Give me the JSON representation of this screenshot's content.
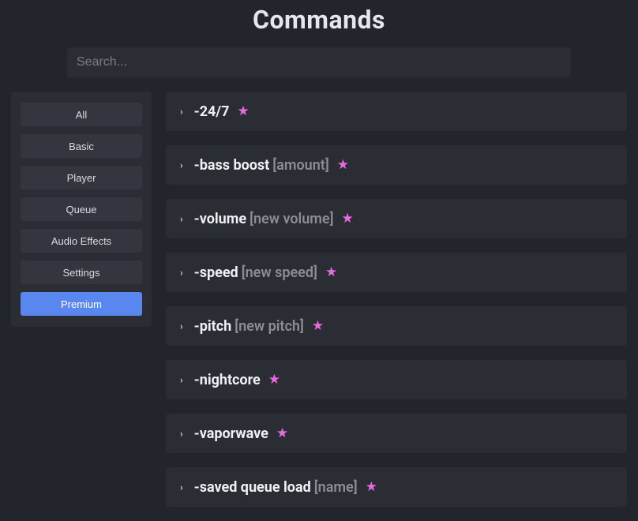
{
  "header": {
    "title": "Commands"
  },
  "search": {
    "placeholder": "Search..."
  },
  "sidebar": {
    "items": [
      {
        "label": "All",
        "active": false
      },
      {
        "label": "Basic",
        "active": false
      },
      {
        "label": "Player",
        "active": false
      },
      {
        "label": "Queue",
        "active": false
      },
      {
        "label": "Audio Effects",
        "active": false
      },
      {
        "label": "Settings",
        "active": false
      },
      {
        "label": "Premium",
        "active": true
      }
    ]
  },
  "commands": [
    {
      "name": "-24/7",
      "args": "",
      "premium": true
    },
    {
      "name": "-bass boost",
      "args": "[amount]",
      "premium": true
    },
    {
      "name": "-volume",
      "args": "[new volume]",
      "premium": true
    },
    {
      "name": "-speed",
      "args": "[new speed]",
      "premium": true
    },
    {
      "name": "-pitch",
      "args": "[new pitch]",
      "premium": true
    },
    {
      "name": "-nightcore",
      "args": "",
      "premium": true
    },
    {
      "name": "-vaporwave",
      "args": "",
      "premium": true
    },
    {
      "name": "-saved queue load",
      "args": "[name]",
      "premium": true
    }
  ]
}
